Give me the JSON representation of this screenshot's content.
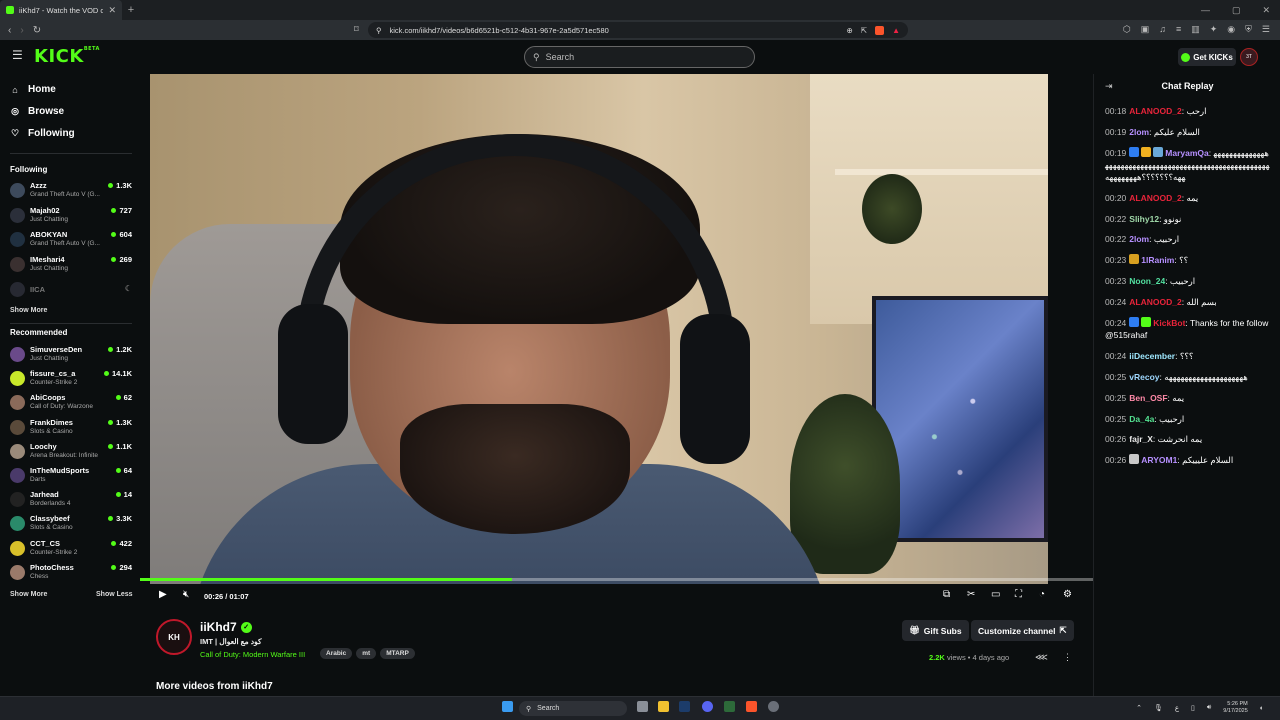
{
  "browser": {
    "tab_title": "iiKhd7 - Watch the VOD on Kick",
    "new_tab": "+",
    "url": "kick.com/iikhd7/videos/b6d6521b-c512-4b31-967e-2a5d571ec580"
  },
  "header": {
    "logo": "KICK",
    "logo_beta": "BETA",
    "search_placeholder": "Search",
    "get_kicks": "Get KICKs",
    "avatar_text": "3T"
  },
  "sidebar": {
    "nav": [
      {
        "label": "Home",
        "icon": "home-icon"
      },
      {
        "label": "Browse",
        "icon": "compass-icon"
      },
      {
        "label": "Following",
        "icon": "heart-icon"
      }
    ],
    "following_title": "Following",
    "following": [
      {
        "name": "Azzz",
        "game": "Grand Theft Auto V (G...",
        "viewers": "1.3K",
        "color": "#3d4a5c"
      },
      {
        "name": "Majah02",
        "game": "Just Chatting",
        "viewers": "727",
        "color": "#2b2f3a"
      },
      {
        "name": "ABOKYAN",
        "game": "Grand Theft Auto V (G...",
        "viewers": "604",
        "color": "#203040"
      },
      {
        "name": "IMeshari4",
        "game": "Just Chatting",
        "viewers": "269",
        "color": "#3a3030"
      }
    ],
    "offline": {
      "name": "IICA",
      "status": "☾"
    },
    "following_show_more": "Show More",
    "recommended_title": "Recommended",
    "recommended": [
      {
        "name": "SimuverseDen",
        "game": "Just Chatting",
        "viewers": "1.2K",
        "color": "#6a4a8a"
      },
      {
        "name": "fissure_cs_a",
        "game": "Counter-Strike 2",
        "viewers": "14.1K",
        "color": "#c8e82a"
      },
      {
        "name": "AbiCoops",
        "game": "Call of Duty: Warzone",
        "viewers": "62",
        "color": "#8a6a5a"
      },
      {
        "name": "FrankDimes",
        "game": "Slots & Casino",
        "viewers": "1.3K",
        "color": "#5a4a3a"
      },
      {
        "name": "Loochy",
        "game": "Arena Breakout: Infinite",
        "viewers": "1.1K",
        "color": "#9a8a7a"
      },
      {
        "name": "InTheMudSports",
        "game": "Darts",
        "viewers": "64",
        "color": "#4a3a6a"
      },
      {
        "name": "Jarhead",
        "game": "Borderlands 4",
        "viewers": "14",
        "color": "#222222"
      },
      {
        "name": "Classybeef",
        "game": "Slots & Casino",
        "viewers": "3.3K",
        "color": "#2a8a6a"
      },
      {
        "name": "CCT_CS",
        "game": "Counter-Strike 2",
        "viewers": "422",
        "color": "#d8c02a"
      },
      {
        "name": "PhotoChess",
        "game": "Chess",
        "viewers": "294",
        "color": "#9a7a6a"
      }
    ],
    "show_more": "Show More",
    "show_less": "Show Less"
  },
  "player": {
    "time": "00:26 / 01:07",
    "progress_fraction": 0.39
  },
  "channel": {
    "avatar_text": "KH",
    "name": "iiKhd7",
    "title": "IMT | كود مع العوال",
    "game": "Call of Duty: Modern Warfare III",
    "tags": [
      "Arabic",
      "mt",
      "MTARP"
    ],
    "gift_subs": "Gift Subs",
    "customize": "Customize channel",
    "views": "2.2K",
    "views_label": "views",
    "age": "4 days ago",
    "more_videos": "More videos from iiKhd7"
  },
  "chat": {
    "title": "Chat Replay",
    "messages": [
      {
        "ts": "00:18",
        "user": "ALANOOD_2",
        "color": "#e8243a",
        "text": "ارحب"
      },
      {
        "ts": "00:19",
        "user": "2lom",
        "color": "#b690ff",
        "text": "السلام عليكم"
      },
      {
        "ts": "00:19",
        "user": "MaryamQa",
        "color": "#b690ff",
        "badges": [
          "#2e7df1",
          "#f0b020",
          "#6aa8d8"
        ],
        "text": "ههههههههههههههههههههههههههههههههههههههههههههههههههههههههههه؟؟؟؟؟؟؟ههههههههه"
      },
      {
        "ts": "00:20",
        "user": "ALANOOD_2",
        "color": "#e8243a",
        "text": "يمه"
      },
      {
        "ts": "00:22",
        "user": "Slihy12",
        "color": "#9fd8a8",
        "text": "نونوو"
      },
      {
        "ts": "00:22",
        "user": "2lom",
        "color": "#b690ff",
        "text": "ارحبيب"
      },
      {
        "ts": "00:23",
        "user": "1lRanim",
        "color": "#b690ff",
        "badges": [
          "#d8a020"
        ],
        "text": "؟؟"
      },
      {
        "ts": "00:23",
        "user": "Noon_24",
        "color": "#53e0a0",
        "text": "ارحبيب"
      },
      {
        "ts": "00:24",
        "user": "ALANOOD_2",
        "color": "#e8243a",
        "text": "بسم الله"
      },
      {
        "ts": "00:24",
        "user": "KickBot",
        "color": "#e8243a",
        "badges": [
          "#2e7df1",
          "#53fc18"
        ],
        "text": "Thanks for the follow @515rahaf"
      },
      {
        "ts": "00:24",
        "user": "iiDecember",
        "color": "#9fe8ff",
        "text": "؟؟؟"
      },
      {
        "ts": "00:25",
        "user": "vRecoy",
        "color": "#9fd8ff",
        "text": "ههههههههههههههههههههه"
      },
      {
        "ts": "00:25",
        "user": "Ben_OSF",
        "color": "#ff8aa8",
        "text": "يمه"
      },
      {
        "ts": "00:25",
        "user": "Da_4a",
        "color": "#53e090",
        "text": "ارحبيب"
      },
      {
        "ts": "00:26",
        "user": "fajr_X",
        "color": "#e8e8e8",
        "text": "يمه انحرشت"
      },
      {
        "ts": "00:26",
        "user": "ARYOM1",
        "color": "#b690ff",
        "badges": [
          "#c8c8c8"
        ],
        "text": "السلام عليييكم"
      }
    ]
  },
  "taskbar": {
    "search": "Search",
    "time": "5:26 PM",
    "date": "9/17/2025"
  }
}
